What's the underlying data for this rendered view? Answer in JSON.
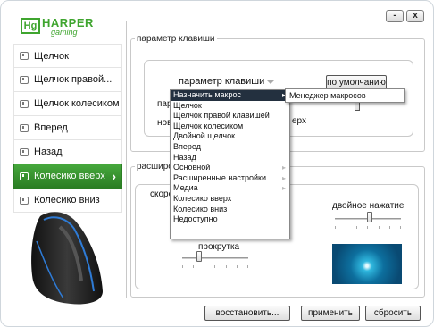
{
  "window": {
    "minimize_label": "-",
    "close_label": "x"
  },
  "logo": {
    "box": "Hg",
    "brand": "HARPER",
    "sub": "gaming"
  },
  "sidebar": {
    "items": [
      {
        "label": "Щелчок"
      },
      {
        "label": "Щелчок правой..."
      },
      {
        "label": "Щелчок колесиком"
      },
      {
        "label": "Вперед"
      },
      {
        "label": "Назад"
      },
      {
        "label": "Колесико вверх",
        "active": true
      },
      {
        "label": "Колесико вниз"
      }
    ]
  },
  "key_param": {
    "group_label": "параметр клавиши",
    "combo_value": "параметр клавиши",
    "default_button": "по умолчанию",
    "partial_label_1": "пар",
    "partial_label_2": "нов",
    "partial_label_3": "ерх"
  },
  "dropdown_menu": {
    "items": [
      {
        "label": "Назначить макрос",
        "has_submenu": true,
        "selected": true
      },
      {
        "label": "Щелчок"
      },
      {
        "label": "Щелчок правой клавишей"
      },
      {
        "label": "Щелчок колесиком"
      },
      {
        "label": "Двойной щелчок"
      },
      {
        "label": "Вперед"
      },
      {
        "label": "Назад"
      },
      {
        "label": "Основной",
        "has_submenu": true
      },
      {
        "label": "Расширенные настройки",
        "has_submenu": true
      },
      {
        "label": "Медиа",
        "has_submenu": true
      },
      {
        "label": "Колесико вверх"
      },
      {
        "label": "Колесико вниз"
      },
      {
        "label": "Недоступно"
      }
    ],
    "submenu_item": "Менеджер макросов"
  },
  "extended": {
    "group_label": "расшире",
    "speed_label_partial": "скоро",
    "double_click_label": "двойное нажатие",
    "scroll_label": "прокрутка"
  },
  "bottom_buttons": {
    "restore": "восстановить...",
    "apply": "применить",
    "reset": "сбросить"
  }
}
